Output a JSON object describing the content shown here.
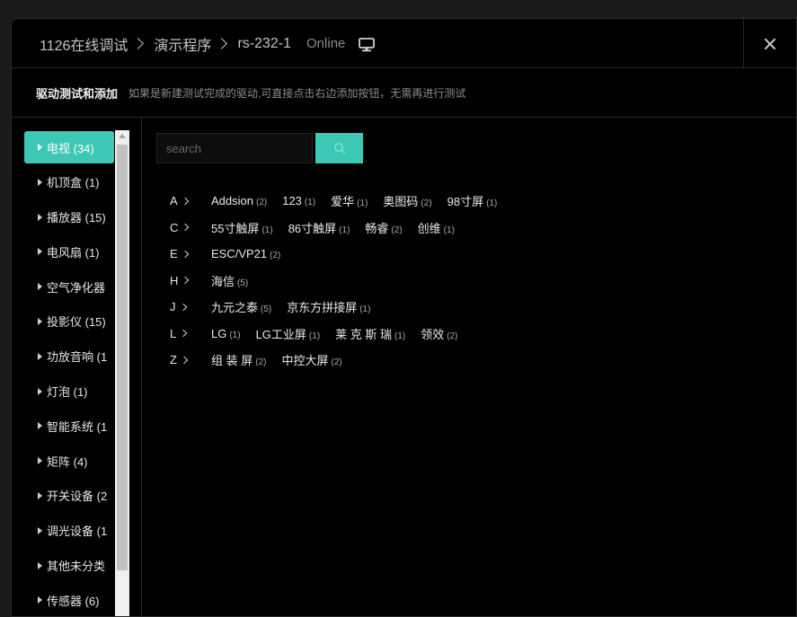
{
  "header": {
    "breadcrumbs": [
      "1126在线调试",
      "演示程序",
      "rs-232-1"
    ],
    "status": "Online",
    "monitor_icon": "monitor-icon",
    "close_icon": "close-icon"
  },
  "subheader": {
    "title": "驱动测试和添加",
    "description": "如果是新建测试完成的驱动,可直接点击右边添加按钮，无需再进行测试"
  },
  "categories": [
    {
      "label": "电视 (34)",
      "active": true
    },
    {
      "label": "机顶盒 (1)"
    },
    {
      "label": "播放器 (15)"
    },
    {
      "label": "电风扇 (1)"
    },
    {
      "label": "空气净化器"
    },
    {
      "label": "投影仪 (15)"
    },
    {
      "label": "功放音响 (1"
    },
    {
      "label": "灯泡 (1)"
    },
    {
      "label": "智能系统 (1"
    },
    {
      "label": "矩阵 (4)"
    },
    {
      "label": "开关设备 (2"
    },
    {
      "label": "调光设备 (1"
    },
    {
      "label": "其他未分类"
    },
    {
      "label": "传感器 (6)"
    }
  ],
  "search": {
    "placeholder": "search",
    "icon": "search-icon"
  },
  "brand_groups": [
    {
      "letter": "A",
      "brands": [
        {
          "name": "Addsion",
          "count": "(2)"
        },
        {
          "name": "123",
          "count": "(1)"
        },
        {
          "name": "爱华",
          "count": "(1)"
        },
        {
          "name": "奥图码",
          "count": "(2)"
        },
        {
          "name": "98寸屏",
          "count": "(1)"
        }
      ]
    },
    {
      "letter": "C",
      "brands": [
        {
          "name": "55寸触屏",
          "count": "(1)"
        },
        {
          "name": "86寸触屏",
          "count": "(1)"
        },
        {
          "name": "畅睿",
          "count": "(2)"
        },
        {
          "name": "创维",
          "count": "(1)"
        }
      ]
    },
    {
      "letter": "E",
      "brands": [
        {
          "name": "ESC/VP21",
          "count": "(2)"
        }
      ]
    },
    {
      "letter": "H",
      "brands": [
        {
          "name": "海信",
          "count": "(5)"
        }
      ]
    },
    {
      "letter": "J",
      "brands": [
        {
          "name": "九元之泰",
          "count": "(5)"
        },
        {
          "name": "京东方拼接屏",
          "count": "(1)"
        }
      ]
    },
    {
      "letter": "L",
      "brands": [
        {
          "name": "LG",
          "count": "(1)"
        },
        {
          "name": "LG工业屏",
          "count": "(1)"
        },
        {
          "name": "莱 克 斯 瑞",
          "count": "(1)"
        },
        {
          "name": "领效",
          "count": "(2)"
        }
      ]
    },
    {
      "letter": "Z",
      "brands": [
        {
          "name": "组 装 屏",
          "count": "(2)"
        },
        {
          "name": "中控大屏",
          "count": "(2)"
        }
      ]
    }
  ],
  "colors": {
    "accent": "#3cc8b4",
    "background": "#000000"
  }
}
